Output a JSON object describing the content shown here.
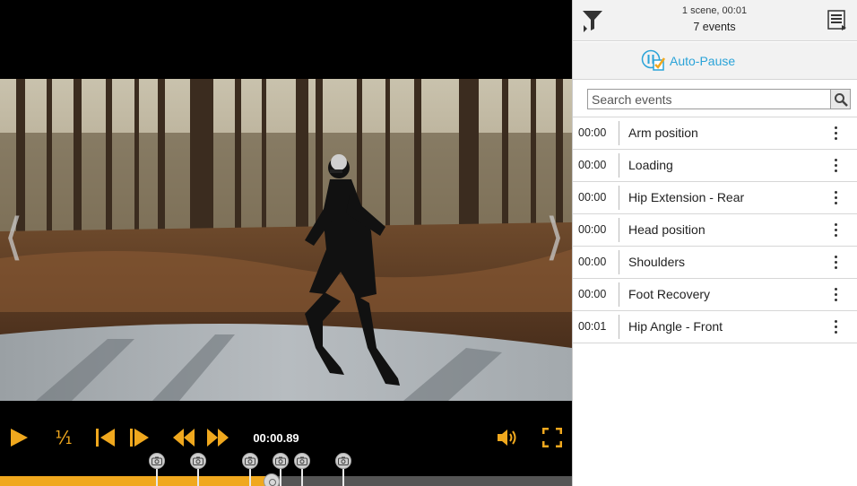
{
  "player": {
    "speed_label": "¹⁄₁",
    "timecode": "00:00.89",
    "progress_fraction": 0.475,
    "marker_positions_fraction": [
      0.275,
      0.347,
      0.438,
      0.491,
      0.528,
      0.601
    ],
    "accent_color": "#f0a81e",
    "icons": {
      "play": "play-icon",
      "step_back": "step-back-icon",
      "step_forward": "step-forward-icon",
      "rewind": "rewind-icon",
      "forward": "fast-forward-icon",
      "volume": "volume-icon",
      "fullscreen": "fullscreen-icon",
      "marker": "camera-icon",
      "prev": "chevron-left-icon",
      "next": "chevron-right-icon"
    }
  },
  "sidebar": {
    "scene_summary": "1 scene, 00:01",
    "event_summary": "7 events",
    "autopause_label": "Auto-Pause",
    "link_color": "#2aa3d8",
    "search_placeholder": "Search events",
    "icons": {
      "filter": "filter-icon",
      "list_view": "list-view-icon",
      "autopause": "autopause-icon",
      "search": "search-icon",
      "menu": "more-vertical-icon"
    },
    "events": [
      {
        "time": "00:00",
        "name": "Arm position"
      },
      {
        "time": "00:00",
        "name": "Loading"
      },
      {
        "time": "00:00",
        "name": "Hip Extension - Rear"
      },
      {
        "time": "00:00",
        "name": "Head position"
      },
      {
        "time": "00:00",
        "name": "Shoulders"
      },
      {
        "time": "00:00",
        "name": "Foot Recovery"
      },
      {
        "time": "00:01",
        "name": "Hip Angle - Front"
      }
    ]
  }
}
